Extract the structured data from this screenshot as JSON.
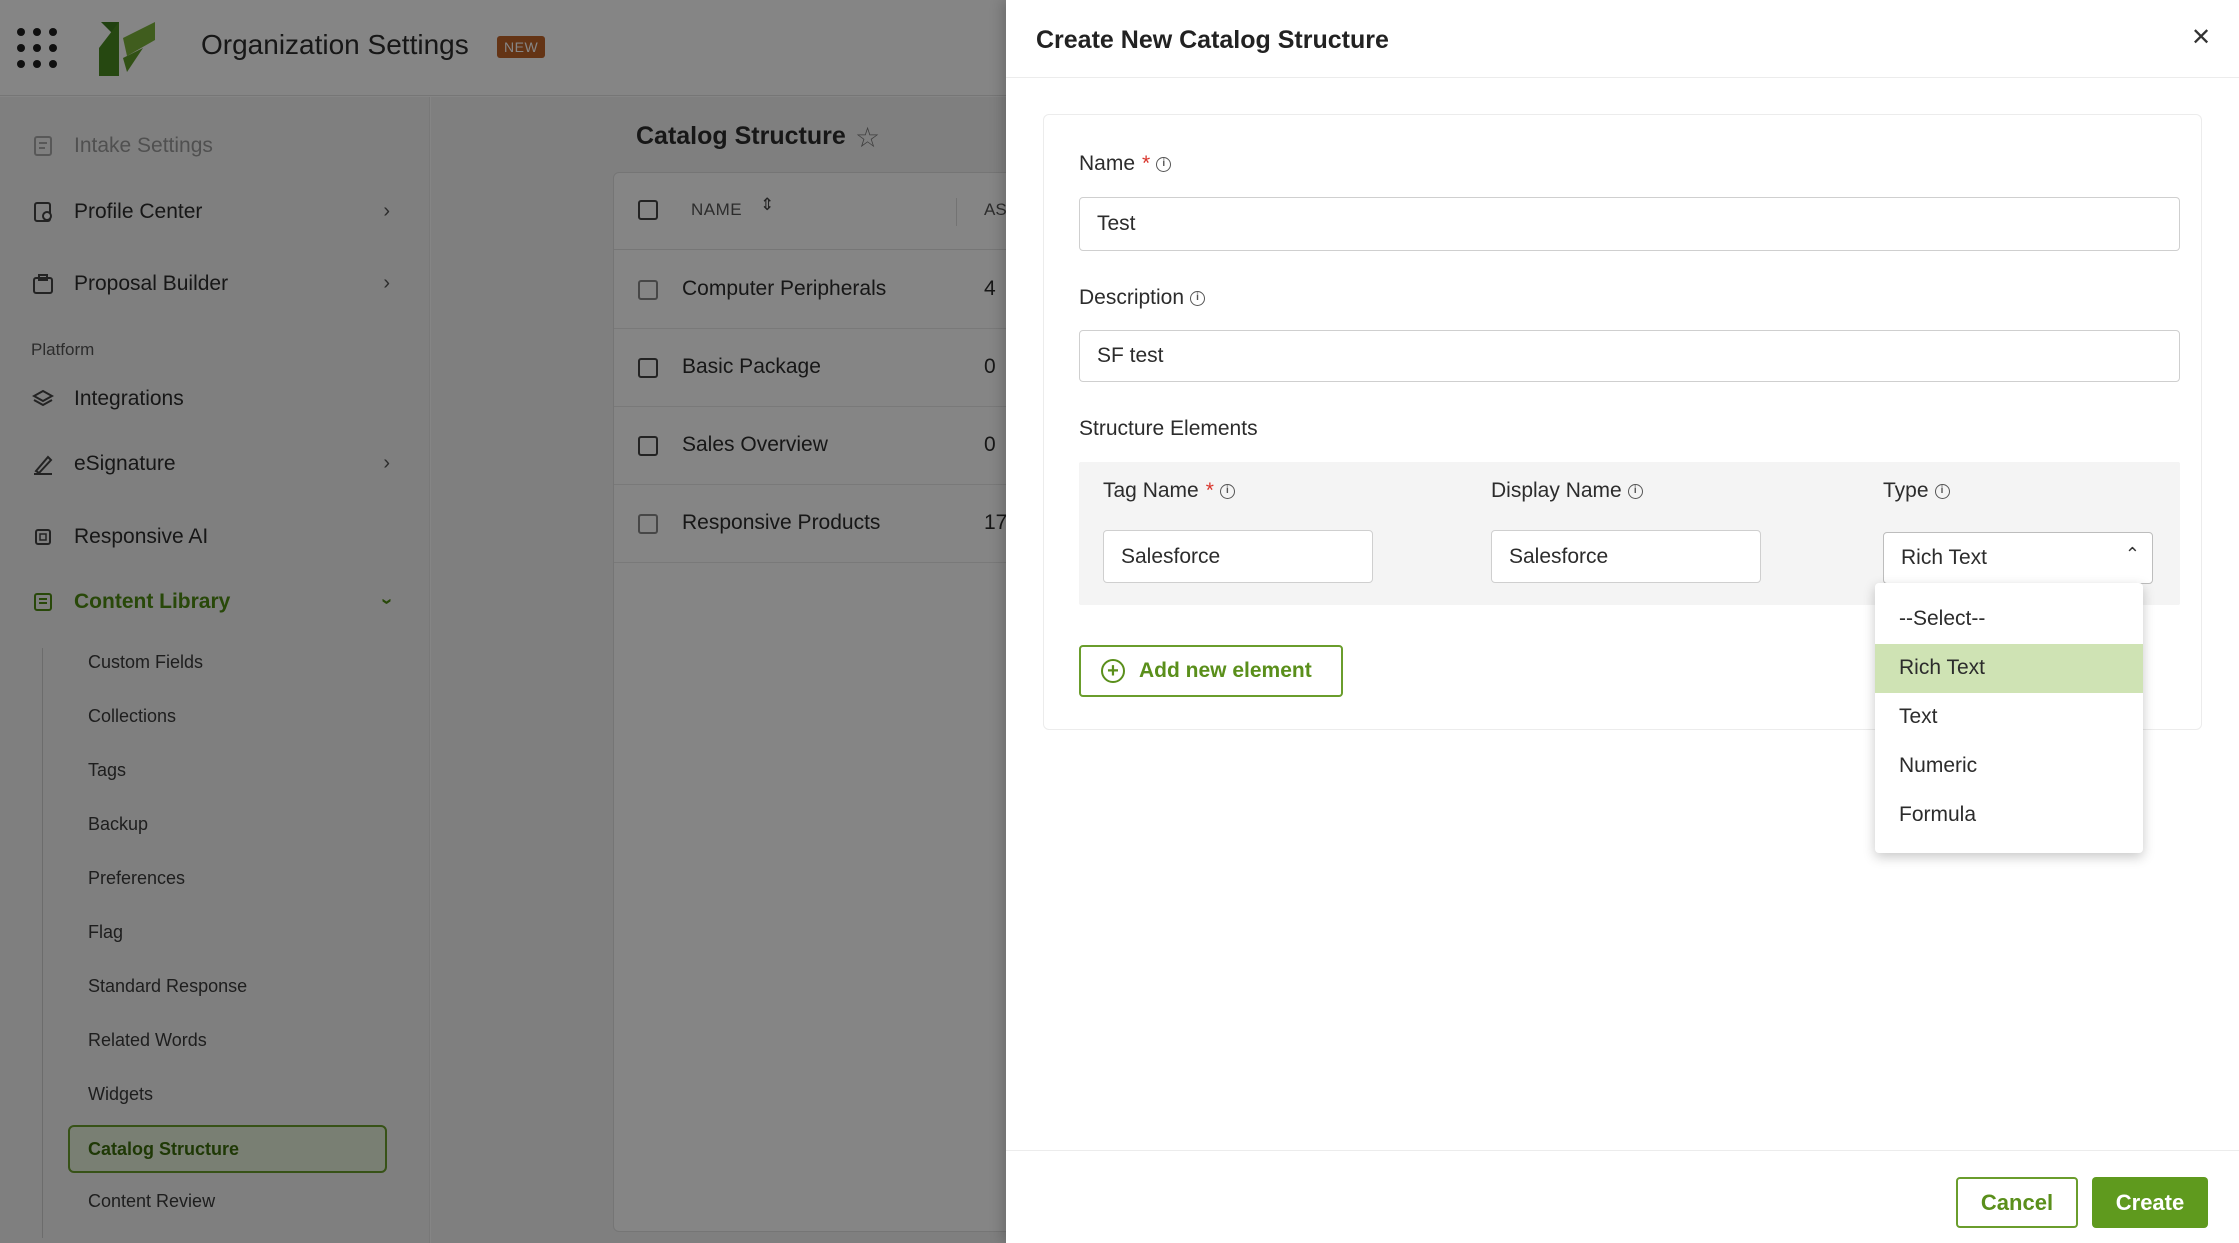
{
  "app": {
    "title": "Organization Settings",
    "badge": "NEW"
  },
  "sidebar": {
    "items": [
      {
        "label": "Intake Settings",
        "icon": "intake-icon"
      },
      {
        "label": "Profile Center",
        "icon": "profile-icon"
      },
      {
        "label": "Proposal Builder",
        "icon": "proposal-icon"
      },
      {
        "label": "Integrations",
        "icon": "layers-icon"
      },
      {
        "label": "eSignature",
        "icon": "pen-icon"
      },
      {
        "label": "Responsive AI",
        "icon": "chip-icon"
      },
      {
        "label": "Content Library",
        "icon": "library-icon"
      }
    ],
    "section_platform": "Platform",
    "content_library_sub": [
      "Custom Fields",
      "Collections",
      "Tags",
      "Backup",
      "Preferences",
      "Flag",
      "Standard Response",
      "Related Words",
      "Widgets",
      "Catalog Structure",
      "Content Review"
    ]
  },
  "main": {
    "title": "Catalog Structure",
    "table": {
      "col_name": "NAME",
      "col_partial": "AS",
      "rows": [
        {
          "name": "Computer Peripherals",
          "count": "4"
        },
        {
          "name": "Basic Package",
          "count": "0"
        },
        {
          "name": "Sales Overview",
          "count": "0"
        },
        {
          "name": "Responsive Products",
          "count": "17"
        }
      ]
    }
  },
  "drawer": {
    "title": "Create New Catalog Structure",
    "name_label": "Name",
    "name_value": "Test",
    "description_label": "Description",
    "description_value": "SF test",
    "structure_label": "Structure Elements",
    "tag_name_label": "Tag Name",
    "tag_name_value": "Salesforce",
    "display_name_label": "Display Name",
    "display_name_value": "Salesforce",
    "type_label": "Type",
    "type_value": "Rich Text",
    "type_options": [
      "--Select--",
      "Rich Text",
      "Text",
      "Numeric",
      "Formula"
    ],
    "add_element_label": "Add new element",
    "cancel_label": "Cancel",
    "create_label": "Create"
  },
  "colors": {
    "accent": "#5f9a1e",
    "highlight": "#cfe3b4",
    "required": "#d9342b",
    "badge": "#c0642a"
  }
}
